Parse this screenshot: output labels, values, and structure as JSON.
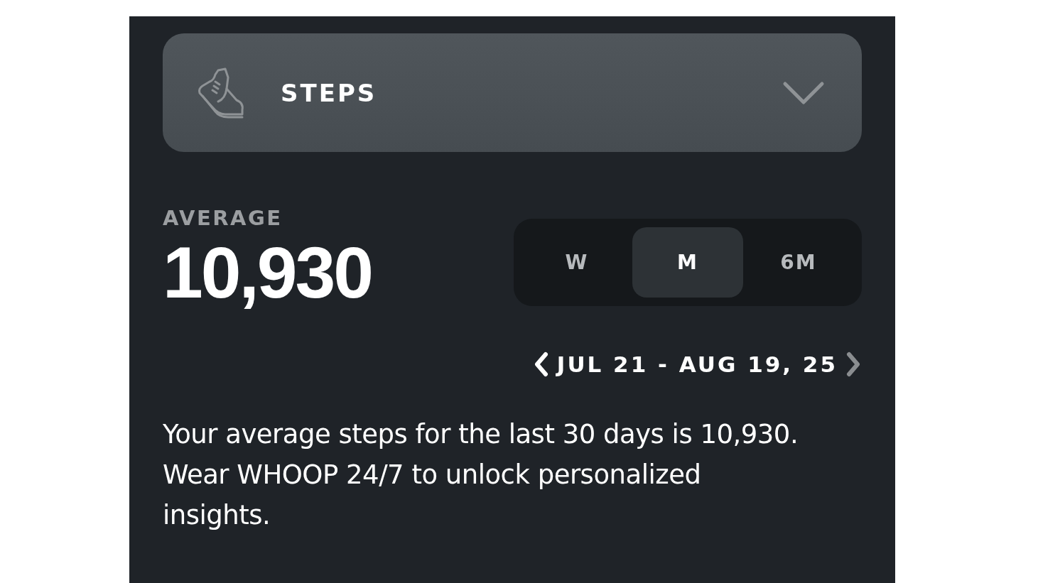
{
  "selector": {
    "label": "STEPS",
    "expanded": false
  },
  "average": {
    "label": "AVERAGE",
    "value": "10,930"
  },
  "periods": [
    {
      "label": "W",
      "selected": false
    },
    {
      "label": "M",
      "selected": true
    },
    {
      "label": "6M",
      "selected": false
    }
  ],
  "date_range": {
    "label": "JUL 21 - AUG 19, 25",
    "prev_disabled": false,
    "next_disabled": true
  },
  "summary": "Your average steps for the last 30 days is 10,930. Wear WHOOP 24/7 to unlock personalized insights."
}
